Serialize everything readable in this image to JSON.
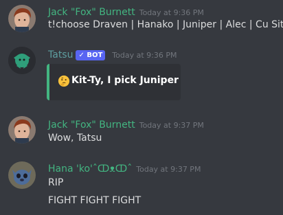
{
  "colors": {
    "background": "#36393f",
    "username_green": "#43b581",
    "bot_name": "#5e9ea0",
    "bot_badge": "#5865f2",
    "timestamp": "#72767d",
    "embed_bg": "#2f3136",
    "embed_border": "#43b581"
  },
  "messages": [
    {
      "author": "Jack \"Fox\" Burnett",
      "timestamp": "Today at 9:36 PM",
      "content": "t!choose Draven | Hanako | Juniper | Alec | Cu Sith",
      "avatar_icon": "redhead-avatar-icon"
    },
    {
      "author": "Tatsu",
      "badge": "✓ BOT",
      "timestamp": "Today at 9:36 PM",
      "embed_text": "Kit-Ty, I pick Juniper",
      "embed_icon": "thinking-face-icon",
      "avatar_icon": "tatsu-bot-avatar-icon"
    },
    {
      "author": "Jack \"Fox\" Burnett",
      "timestamp": "Today at 9:37 PM",
      "content": "Wow, Tatsu",
      "avatar_icon": "redhead-avatar-icon"
    },
    {
      "author": "Hana 'ko'ˆↀᴥↀˆ",
      "timestamp": "Today at 9:37 PM",
      "lines": [
        "RIP",
        "FIGHT FIGHT FIGHT"
      ],
      "avatar_icon": "stitch-avatar-icon"
    }
  ]
}
